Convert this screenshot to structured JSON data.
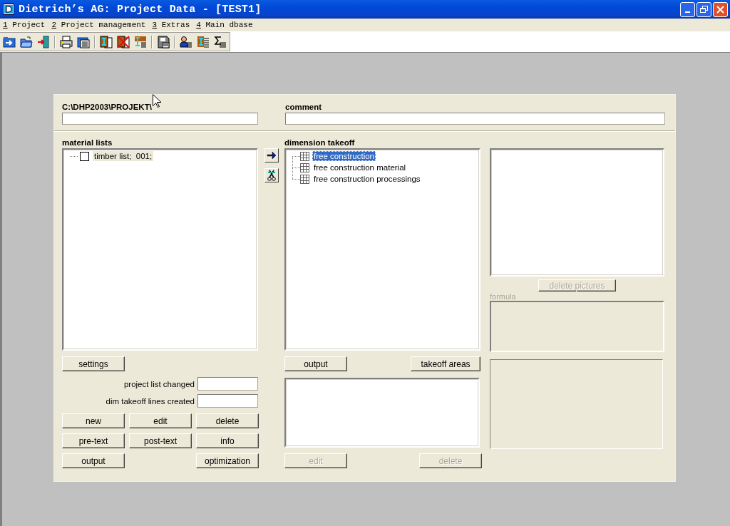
{
  "window": {
    "title": "Dietrich’s AG: Project Data - [TEST1]"
  },
  "menu": [
    {
      "mnemonic": "1",
      "label": " Project"
    },
    {
      "mnemonic": "2",
      "label": " Project management"
    },
    {
      "mnemonic": "3",
      "label": " Extras"
    },
    {
      "mnemonic": "4",
      "label": " Main dbase"
    }
  ],
  "dialog": {
    "path_label": "C:\\DHP2003\\PROJEKT\\",
    "comment_label": "comment",
    "material_lists": {
      "label": "material lists",
      "items": [
        {
          "label": "timber list;  001;",
          "checked": false,
          "selected": true
        }
      ]
    },
    "dimension_takeoff": {
      "label": "dimension takeoff",
      "items": [
        {
          "label": "free construction",
          "selected": true
        },
        {
          "label": "free construction material",
          "selected": false
        },
        {
          "label": "free construction processings",
          "selected": false
        }
      ]
    },
    "delete_pictures": {
      "label": "delete pictures",
      "disabled": true
    },
    "formula_label": "formula",
    "settings_button": {
      "label": "settings",
      "disabled": false
    },
    "status_fields": [
      {
        "label": "project list changed"
      },
      {
        "label": "dim takeoff lines created"
      }
    ],
    "list_buttons": [
      [
        {
          "label": "new",
          "disabled": false
        },
        {
          "label": "edit",
          "disabled": false
        },
        {
          "label": "delete",
          "disabled": false
        }
      ],
      [
        {
          "label": "pre-text",
          "disabled": false
        },
        {
          "label": "post-text",
          "disabled": false
        },
        {
          "label": "info",
          "disabled": false
        }
      ],
      [
        {
          "label": "output",
          "disabled": false
        },
        {
          "label": "optimization",
          "disabled": false
        }
      ]
    ],
    "takeoff_buttons": [
      {
        "label": "output",
        "disabled": false
      },
      {
        "label": "takeoff areas",
        "disabled": false
      }
    ],
    "area_buttons": [
      {
        "label": "edit",
        "disabled": true
      },
      {
        "label": "delete",
        "disabled": true
      }
    ]
  }
}
